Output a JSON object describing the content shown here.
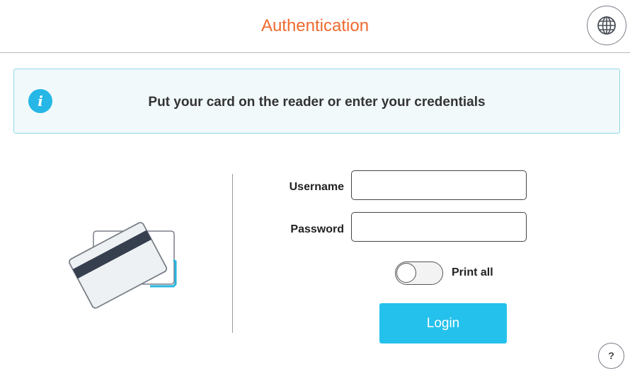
{
  "header": {
    "title": "Authentication",
    "language_icon": "globe-icon"
  },
  "info": {
    "icon_glyph": "i",
    "icon": "info-icon",
    "message": "Put your card on the reader or enter your credentials"
  },
  "illustration": {
    "icon": "card-reader-icon"
  },
  "form": {
    "username_label": "Username",
    "username_value": "",
    "password_label": "Password",
    "password_value": "",
    "print_all_label": "Print all",
    "print_all_enabled": false,
    "login_label": "Login"
  },
  "help": {
    "label": "?"
  },
  "colors": {
    "title": "#ef6a2e",
    "accent": "#24c1ec",
    "info_bg": "#f1f9fb",
    "info_border": "#8fd9e8",
    "card_stripe": "#363f4e"
  }
}
